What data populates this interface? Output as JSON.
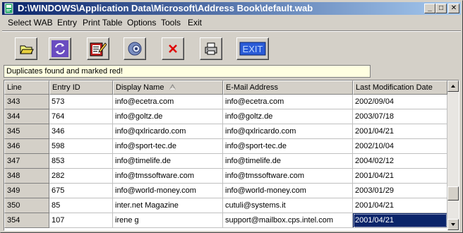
{
  "window": {
    "title": "D:\\WINDOWS\\Application Data\\Microsoft\\Address Book\\default.wab",
    "minimize_glyph": "_",
    "maximize_glyph": "□",
    "close_glyph": "✕"
  },
  "menu": {
    "items": [
      "Select WAB",
      "Entry",
      "Print Table",
      "Options",
      "Tools",
      "Exit"
    ]
  },
  "toolbar": {
    "buttons": [
      {
        "icon": "open-folder-icon"
      },
      {
        "icon": "refresh-icon"
      },
      {
        "icon": "edit-card-icon"
      },
      {
        "icon": "search-icon"
      },
      {
        "icon": "delete-icon"
      },
      {
        "icon": "print-icon"
      },
      {
        "icon": "exit-icon",
        "label": "EXIT"
      }
    ]
  },
  "status": {
    "message": "Duplicates found and marked red!"
  },
  "table": {
    "columns": [
      "Line",
      "Entry ID",
      "Display Name",
      "E-Mail Address",
      "Last Modification Date"
    ],
    "sort_column": "Display Name",
    "rows": [
      [
        "343",
        "573",
        "info@ecetra.com",
        "info@ecetra.com",
        "2002/09/04"
      ],
      [
        "344",
        "764",
        "info@goltz.de",
        "info@goltz.de",
        "2003/07/18"
      ],
      [
        "345",
        "346",
        "info@qxlricardo.com",
        "info@qxlricardo.com",
        "2001/04/21"
      ],
      [
        "346",
        "598",
        "info@sport-tec.de",
        "info@sport-tec.de",
        "2002/10/04"
      ],
      [
        "347",
        "853",
        "info@timelife.de",
        "info@timelife.de",
        "2004/02/12"
      ],
      [
        "348",
        "282",
        "info@tmssoftware.com",
        "info@tmssoftware.com",
        "2001/04/21"
      ],
      [
        "349",
        "675",
        "info@world-money.com",
        "info@world-money.com",
        "2003/01/29"
      ],
      [
        "350",
        "85",
        "inter.net Magazine",
        "cutuli@systems.it",
        "2001/04/21"
      ],
      [
        "354",
        "107",
        "irene g",
        "support@mailbox.cps.intel.com",
        "2001/04/21"
      ]
    ],
    "selected": {
      "row": 8,
      "col": 4
    }
  },
  "colors": {
    "titlebar_start": "#0a246a",
    "titlebar_end": "#a6caf0",
    "selection": "#0a246a",
    "status_background": "#ffffe1"
  }
}
